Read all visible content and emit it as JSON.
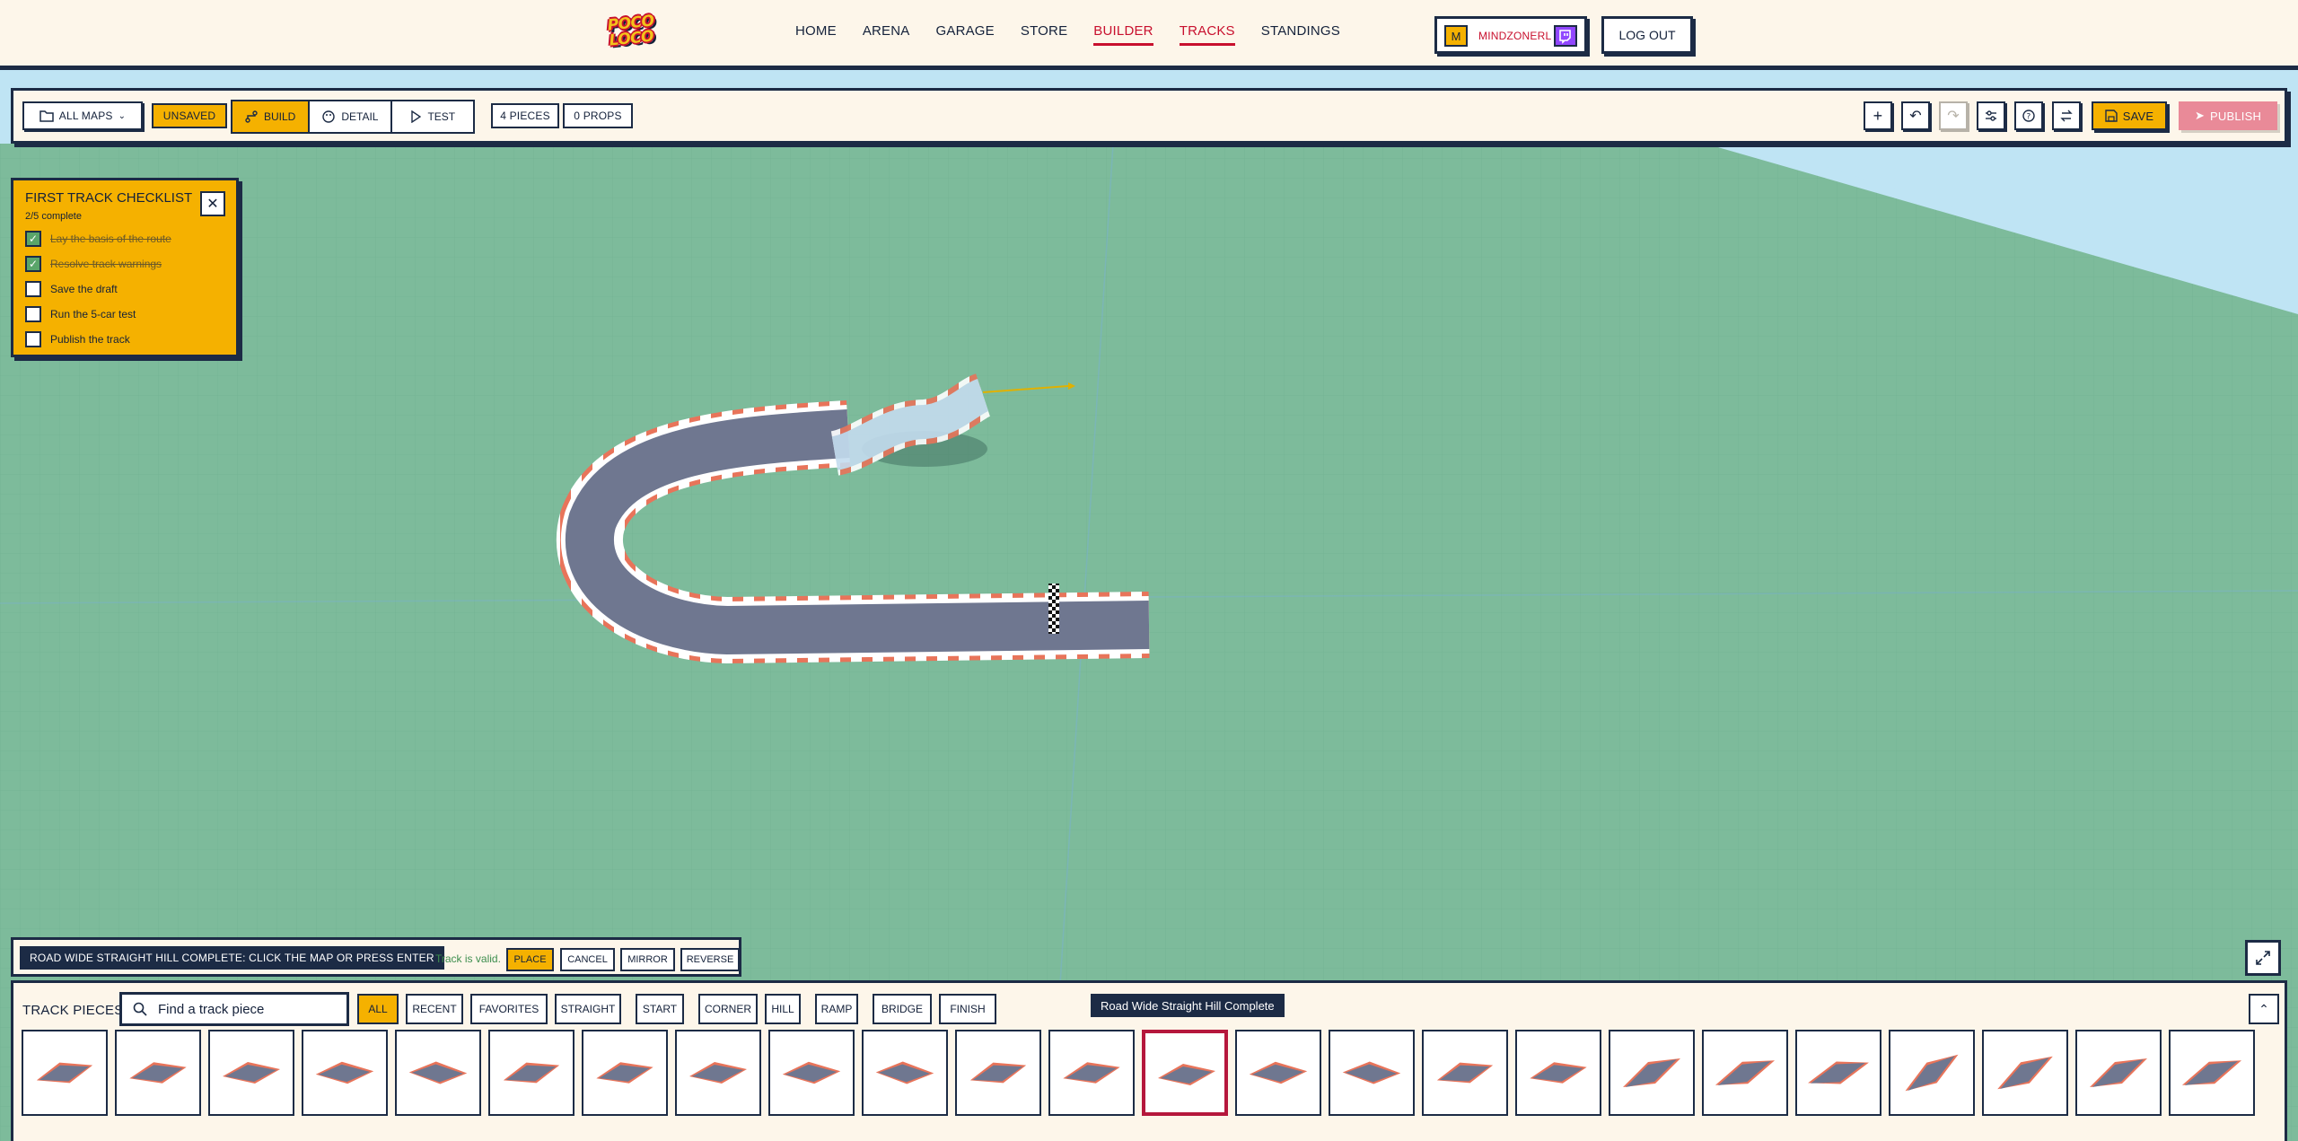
{
  "nav": {
    "logo_line1": "POCO",
    "logo_line2": "LOCO",
    "items": [
      {
        "label": "HOME",
        "active": false
      },
      {
        "label": "ARENA",
        "active": false
      },
      {
        "label": "GARAGE",
        "active": false
      },
      {
        "label": "STORE",
        "active": false
      },
      {
        "label": "BUILDER",
        "active": true
      },
      {
        "label": "TRACKS",
        "active": true
      },
      {
        "label": "STANDINGS",
        "active": false
      }
    ],
    "avatar_letter": "M",
    "username": "MINDZONERL",
    "logout_label": "LOG OUT"
  },
  "toolbar": {
    "maps_label": "ALL MAPS",
    "unsaved_label": "UNSAVED",
    "modes": [
      "BUILD",
      "DETAIL",
      "TEST"
    ],
    "pieces_count": "4 PIECES",
    "props_count": "0 PROPS",
    "save_label": "SAVE",
    "publish_label": "PUBLISH",
    "icons": [
      "plus-icon",
      "undo-icon",
      "redo-icon",
      "sliders-icon",
      "help-icon",
      "swap-icon"
    ]
  },
  "checklist": {
    "title": "FIRST TRACK CHECKLIST",
    "progress": "2/5 complete",
    "items": [
      {
        "label": "Lay the basis of the route",
        "done": true
      },
      {
        "label": "Resolve track warnings",
        "done": true
      },
      {
        "label": "Save the draft",
        "done": false
      },
      {
        "label": "Run the 5-car test",
        "done": false
      },
      {
        "label": "Publish the track",
        "done": false
      }
    ]
  },
  "status": {
    "message": "ROAD WIDE STRAIGHT HILL COMPLETE: CLICK THE MAP OR PRESS ENTER",
    "valid_text": "Track is valid.",
    "place_label": "PLACE",
    "cancel_label": "CANCEL",
    "mirror_label": "MIRROR",
    "reverse_label": "REVERSE"
  },
  "tray": {
    "label": "TRACK PIECES",
    "search_placeholder": "Find a track piece",
    "filters": [
      "ALL",
      "RECENT",
      "FAVORITES",
      "STRAIGHT",
      "START",
      "CORNER",
      "HILL",
      "RAMP",
      "BRIDGE",
      "FINISH"
    ],
    "selected_filter": "ALL",
    "tooltip": "Road Wide Straight Hill Complete",
    "selected_piece_index": 12,
    "piece_count": 24
  },
  "colors": {
    "accent_yellow": "#f5b100",
    "ink": "#1c2b45",
    "active_red": "#c8102e",
    "ground_green": "#7dbb9b",
    "sky_blue": "#bfe4f4",
    "publish_pink": "#e98a98"
  }
}
